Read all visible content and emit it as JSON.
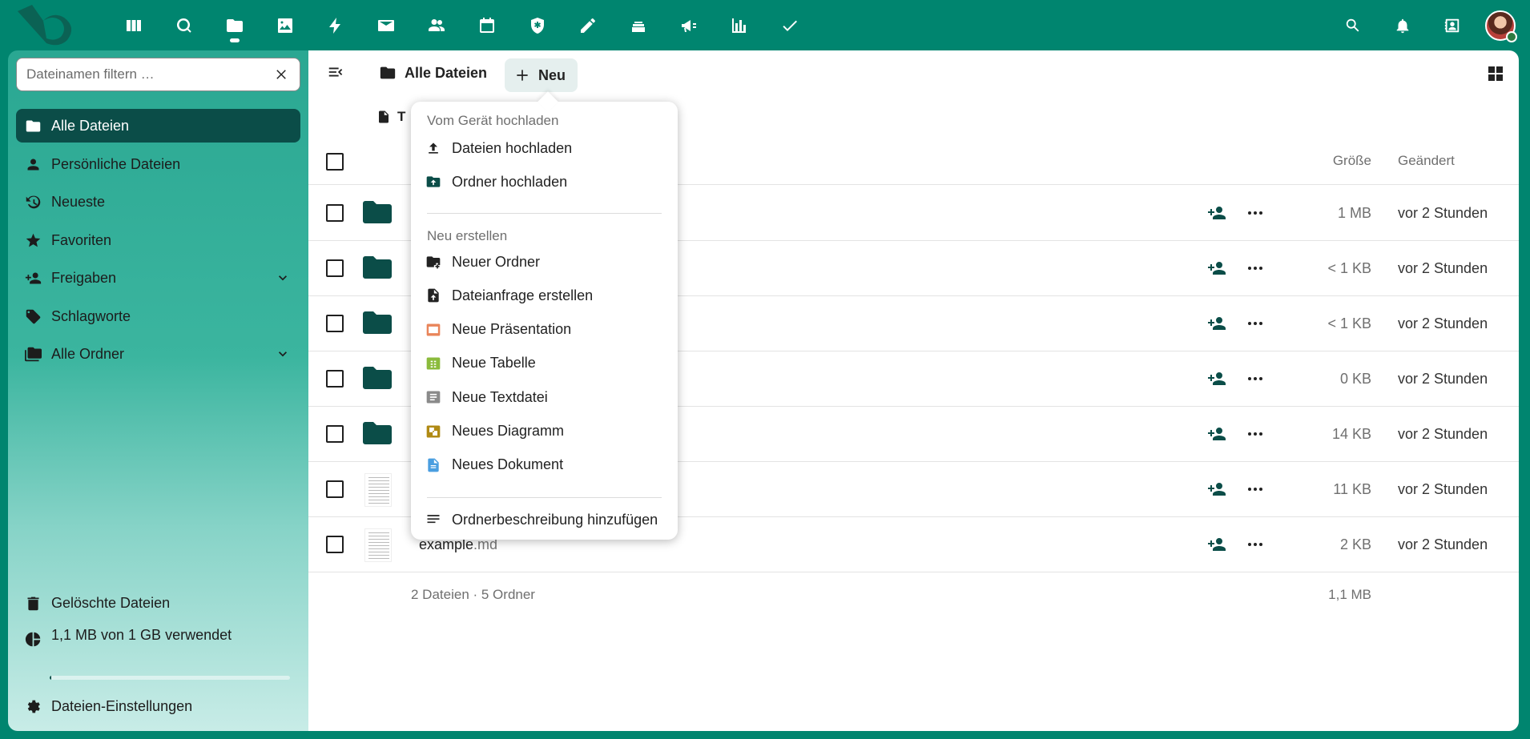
{
  "topbar": {
    "apps": [
      {
        "icon": "dashboard-icon",
        "name": "Dashboard"
      },
      {
        "icon": "search-circle-icon",
        "name": "Suche"
      },
      {
        "icon": "folder-icon",
        "name": "Dateien",
        "active": true
      },
      {
        "icon": "image-icon",
        "name": "Fotos"
      },
      {
        "icon": "activity-icon",
        "name": "Aktivität"
      },
      {
        "icon": "mail-icon",
        "name": "Mail"
      },
      {
        "icon": "contacts-icon",
        "name": "Kontakte"
      },
      {
        "icon": "calendar-icon",
        "name": "Kalender"
      },
      {
        "icon": "shield-icon",
        "name": "Sicherheit"
      },
      {
        "icon": "pencil-icon",
        "name": "Notizen"
      },
      {
        "icon": "deck-icon",
        "name": "Deck"
      },
      {
        "icon": "announcement-icon",
        "name": "Ankündigungen"
      },
      {
        "icon": "chart-icon",
        "name": "Statistik"
      },
      {
        "icon": "checkmark-icon",
        "name": "Aufgaben"
      }
    ]
  },
  "sidebar": {
    "filter_placeholder": "Dateinamen filtern …",
    "items": [
      {
        "label": "Alle Dateien",
        "icon": "folder-icon",
        "active": true
      },
      {
        "label": "Persönliche Dateien",
        "icon": "person-icon"
      },
      {
        "label": "Neueste",
        "icon": "history-icon"
      },
      {
        "label": "Favoriten",
        "icon": "star-icon"
      },
      {
        "label": "Freigaben",
        "icon": "share-icon",
        "expandable": true
      },
      {
        "label": "Schlagworte",
        "icon": "tag-icon"
      },
      {
        "label": "Alle Ordner",
        "icon": "folder-multiple-icon",
        "expandable": true
      }
    ],
    "footer": {
      "trash_label": "Gelöschte Dateien",
      "quota_label": "1,1 MB von 1 GB verwendet",
      "quota_fraction": 0.0011,
      "settings_label": "Dateien-Einstellungen"
    }
  },
  "content": {
    "breadcrumb_label": "Alle Dateien",
    "new_button_label": "Neu",
    "template_chip_label": "T",
    "columns": {
      "size": "Größe",
      "modified": "Geändert"
    },
    "rows": [
      {
        "type": "folder",
        "name": "",
        "ext": "",
        "size": "1 MB",
        "modified": "vor 2 Stunden"
      },
      {
        "type": "folder",
        "name": "",
        "ext": "",
        "size": "< 1 KB",
        "modified": "vor 2 Stunden"
      },
      {
        "type": "folder",
        "name": "",
        "ext": "",
        "size": "< 1 KB",
        "modified": "vor 2 Stunden"
      },
      {
        "type": "folder",
        "name": "",
        "ext": "",
        "size": "0 KB",
        "modified": "vor 2 Stunden"
      },
      {
        "type": "folder",
        "name": "",
        "ext": "",
        "size": "14 KB",
        "modified": "vor 2 Stunden"
      },
      {
        "type": "document",
        "name": "",
        "ext": "",
        "size": "11 KB",
        "modified": "vor 2 Stunden"
      },
      {
        "type": "document",
        "name": "example",
        "ext": ".md",
        "size": "2 KB",
        "modified": "vor 2 Stunden"
      }
    ],
    "summary_text": "2 Dateien · 5 Ordner",
    "summary_size": "1,1 MB"
  },
  "new_menu": {
    "upload_caption": "Vom Gerät hochladen",
    "upload_items": [
      {
        "label": "Dateien hochladen",
        "icon": "upload-icon",
        "color": "#222222"
      },
      {
        "label": "Ordner hochladen",
        "icon": "folder-upload-icon",
        "color": "#0b4d48"
      }
    ],
    "create_caption": "Neu erstellen",
    "create_items": [
      {
        "label": "Neuer Ordner",
        "icon": "folder-plus-icon",
        "color": "#222222"
      },
      {
        "label": "Dateianfrage erstellen",
        "icon": "file-request-icon",
        "color": "#222222"
      },
      {
        "label": "Neue Präsentation",
        "icon": "presentation-icon",
        "color": "#e9855a"
      },
      {
        "label": "Neue Tabelle",
        "icon": "spreadsheet-icon",
        "color": "#8bbb3c"
      },
      {
        "label": "Neue Textdatei",
        "icon": "text-file-icon",
        "color": "#8a8a8a"
      },
      {
        "label": "Neues Diagramm",
        "icon": "diagram-icon",
        "color": "#b08a14"
      },
      {
        "label": "Neues Dokument",
        "icon": "document-icon",
        "color": "#4a9ee0"
      }
    ],
    "extra_items": [
      {
        "label": "Ordnerbeschreibung hinzufügen",
        "icon": "description-icon",
        "color": "#222222"
      }
    ]
  },
  "colors": {
    "brand": "#00856f",
    "active": "#0b4d48"
  }
}
